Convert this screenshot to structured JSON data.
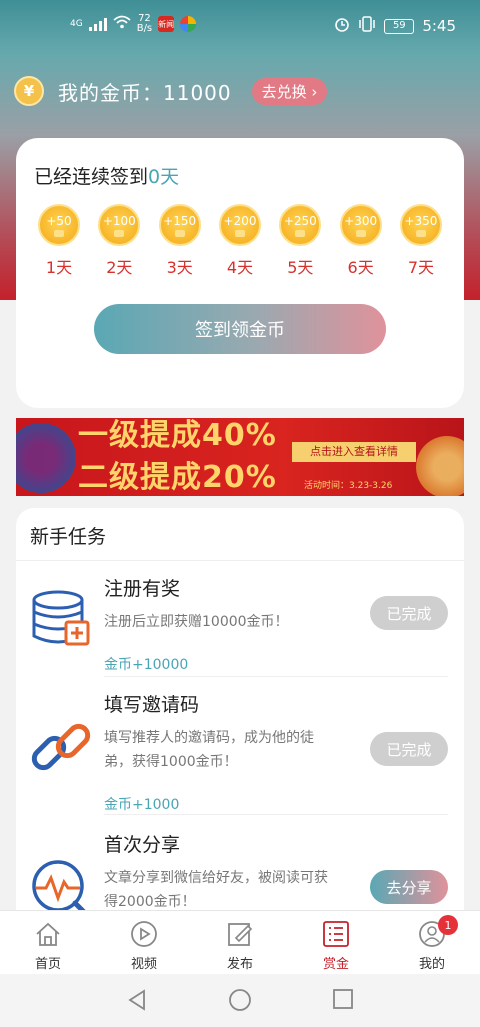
{
  "status_bar": {
    "network": "4G",
    "speed_value": "72",
    "speed_unit": "B/s",
    "app_badge": "新闻",
    "battery": "59",
    "time": "5:45"
  },
  "wallet": {
    "label": "我的金币：11000",
    "exchange_label": "去兑换"
  },
  "checkin": {
    "streak_prefix": "已经连续签到",
    "streak_days": "0天",
    "days": [
      {
        "reward": "+50",
        "label": "1天"
      },
      {
        "reward": "+100",
        "label": "2天"
      },
      {
        "reward": "+150",
        "label": "3天"
      },
      {
        "reward": "+200",
        "label": "4天"
      },
      {
        "reward": "+250",
        "label": "5天"
      },
      {
        "reward": "+300",
        "label": "6天"
      },
      {
        "reward": "+350",
        "label": "7天"
      }
    ],
    "button_label": "签到领金币"
  },
  "banner": {
    "line1": "一级提成40%",
    "line2": "二级提成20%",
    "cta": "点击进入查看详情",
    "period": "活动时间：3.23-3.26"
  },
  "tasks": {
    "title": "新手任务",
    "items": [
      {
        "title": "注册有奖",
        "desc": "注册后立即获赠10000金币！",
        "reward": "金币+10000",
        "button": "已完成",
        "icon": "database-plus-icon"
      },
      {
        "title": "填写邀请码",
        "desc": "填写推荐人的邀请码，成为他的徒弟，获得1000金币！",
        "reward": "金币+1000",
        "button": "已完成",
        "icon": "link-icon"
      },
      {
        "title": "首次分享",
        "desc": "文章分享到微信给好友，被阅读可获得2000金币！",
        "reward": "",
        "button": "去分享",
        "icon": "magnifier-pulse-icon"
      }
    ]
  },
  "nav": {
    "items": [
      {
        "label": "首页",
        "icon": "home-icon"
      },
      {
        "label": "视频",
        "icon": "play-icon"
      },
      {
        "label": "发布",
        "icon": "edit-icon"
      },
      {
        "label": "赏金",
        "icon": "list-icon"
      },
      {
        "label": "我的",
        "icon": "user-icon"
      }
    ],
    "badge": "1"
  },
  "colors": {
    "accent": "#c4212b",
    "teal": "#4aa5b3",
    "coin": "#f7b52a"
  }
}
